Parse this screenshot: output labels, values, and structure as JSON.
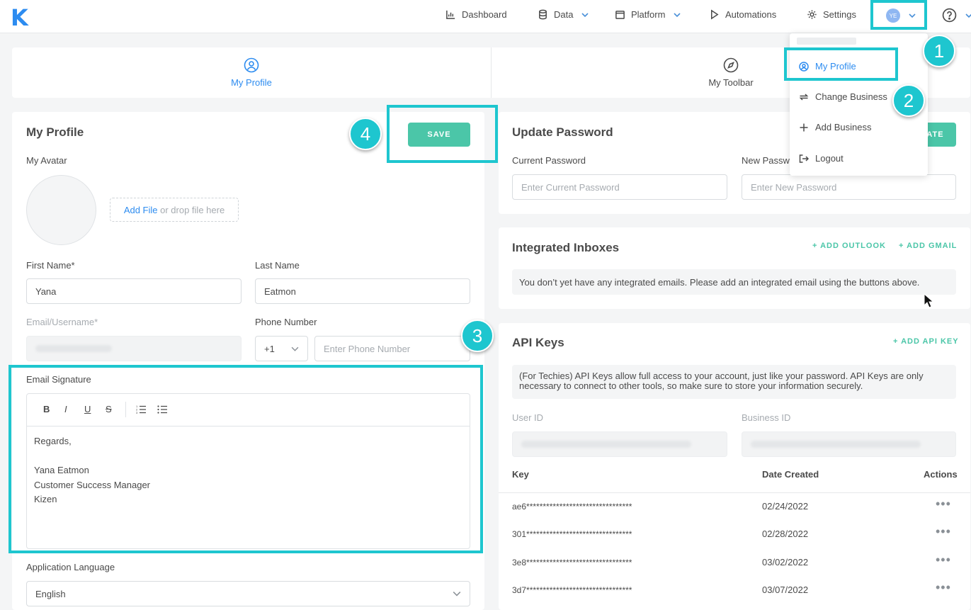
{
  "nav": {
    "logo": "K",
    "items": [
      {
        "label": "Dashboard"
      },
      {
        "label": "Data"
      },
      {
        "label": "Platform"
      },
      {
        "label": "Automations"
      },
      {
        "label": "Settings"
      }
    ],
    "avatar_initials": "YE"
  },
  "tabs": [
    {
      "label": "My Profile",
      "active": true
    },
    {
      "label": "My Toolbar",
      "active": false
    }
  ],
  "dropdown": {
    "items": [
      {
        "label": "My Profile"
      },
      {
        "label": "Change Business"
      },
      {
        "label": "Add Business"
      },
      {
        "label": "Logout"
      }
    ]
  },
  "annotations": [
    "1",
    "2",
    "3",
    "4"
  ],
  "profile": {
    "title": "My Profile",
    "save_label": "SAVE",
    "avatar_label": "My Avatar",
    "add_file": "Add File",
    "drop_text": " or drop file here",
    "first_name_label": "First Name*",
    "first_name_value": "Yana",
    "last_name_label": "Last Name",
    "last_name_value": "Eatmon",
    "email_label": "Email/Username*",
    "phone_label": "Phone Number",
    "phone_code": "+1",
    "phone_placeholder": "Enter Phone Number",
    "signature_label": "Email Signature",
    "signature_lines": [
      "Regards,",
      "",
      "Yana Eatmon",
      "Customer Success Manager",
      "Kizen"
    ],
    "toolbar": {
      "bold": "B",
      "italic": "I",
      "underline": "U",
      "strike": "S"
    },
    "language_label": "Application Language",
    "language_value": "English"
  },
  "password": {
    "title": "Update Password",
    "update_label": "ATE",
    "current_label": "Current Password",
    "current_placeholder": "Enter Current Password",
    "new_label": "New Passw",
    "new_placeholder": "Enter New Password"
  },
  "inboxes": {
    "title": "Integrated Inboxes",
    "add_outlook": "+ ADD OUTLOOK",
    "add_gmail": "+ ADD GMAIL",
    "empty_text": "You don’t yet have any integrated emails. Please add an integrated email using the buttons above."
  },
  "api": {
    "title": "API Keys",
    "add_key": "+ ADD API KEY",
    "info": "(For Techies) API Keys allow full access to your account, just like your password. API Keys are only necessary to connect to other tools, so make sure to store your information securely.",
    "user_id_label": "User ID",
    "business_id_label": "Business ID",
    "columns": {
      "key": "Key",
      "date": "Date Created",
      "actions": "Actions"
    },
    "rows": [
      {
        "key": "ae6********************************",
        "date": "02/24/2022"
      },
      {
        "key": "301********************************",
        "date": "02/28/2022"
      },
      {
        "key": "3e8********************************",
        "date": "03/02/2022"
      },
      {
        "key": "3d7********************************",
        "date": "03/07/2022"
      }
    ]
  }
}
